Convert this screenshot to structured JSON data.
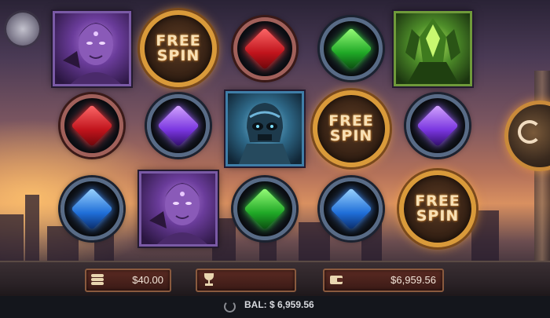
{
  "game": {
    "reels": [
      [
        "villain-purple",
        "gem-red",
        "gem-blue"
      ],
      [
        "free-spin",
        "gem-purple",
        "villain-purple"
      ],
      [
        "gem-red",
        "skull-robot-blue",
        "gem-green"
      ],
      [
        "gem-green",
        "free-spin",
        "gem-blue"
      ],
      [
        "alien-green",
        "gem-purple",
        "free-spin"
      ]
    ],
    "free_spin_text": {
      "line1": "FREE",
      "line2": "SPIN"
    }
  },
  "controls": {
    "menu_icon": "circle-menu-icon",
    "spin_icon": "spin-refresh-icon"
  },
  "bar": {
    "bet": {
      "icon": "coins-icon",
      "value": "$40.00"
    },
    "win": {
      "icon": "trophy-icon",
      "value": ""
    },
    "balance": {
      "icon": "wallet-icon",
      "value": "$6,959.56"
    }
  },
  "footer": {
    "balance_text": "BAL: $ 6,959.56",
    "icon": "reload-icon"
  },
  "colors": {
    "coin_rim": "#d99a3a",
    "field_bg": "#5a2a22",
    "gem_red": "#c0141c",
    "gem_green": "#1fa826",
    "gem_blue": "#1f6ed8",
    "gem_purple": "#7a36e0"
  }
}
